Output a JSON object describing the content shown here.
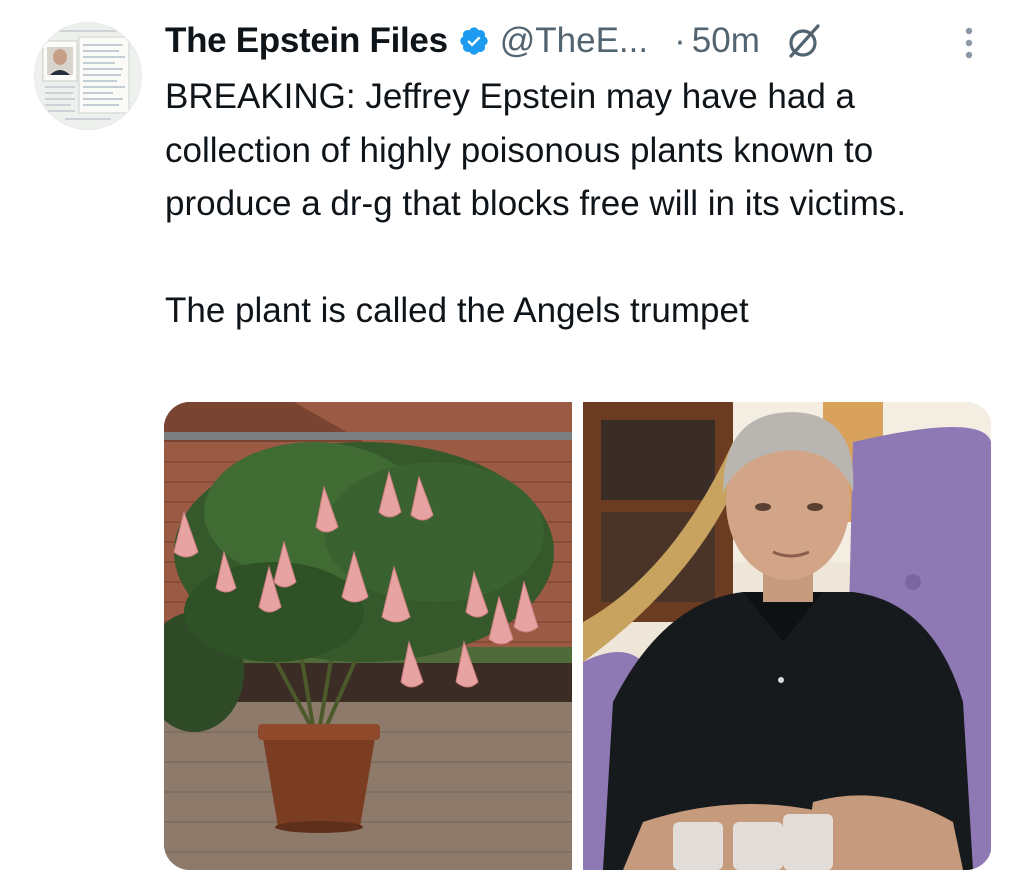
{
  "tweet": {
    "author": {
      "name": "The Epstein Files",
      "handle": "@TheE...",
      "verified": true,
      "avatar": "document-collage-avatar"
    },
    "separator": "·",
    "time": "50m",
    "icons": {
      "verified": "verified-badge-icon",
      "grok": "grok-icon",
      "more": "more-options-icon"
    },
    "colors": {
      "verified": "#1d9bf0",
      "text": "#0f1419",
      "secondary": "#536471"
    },
    "text": {
      "paragraph1": "BREAKING: Jeffrey Epstein may have had a collection of highly poisonous plants known to produce a dr-g that blocks free will in its victims.",
      "paragraph2": "The plant is called the Angels trumpet"
    },
    "media": [
      {
        "subject": "angels-trumpet-plant-photo"
      },
      {
        "subject": "man-portrait-photo"
      }
    ]
  }
}
